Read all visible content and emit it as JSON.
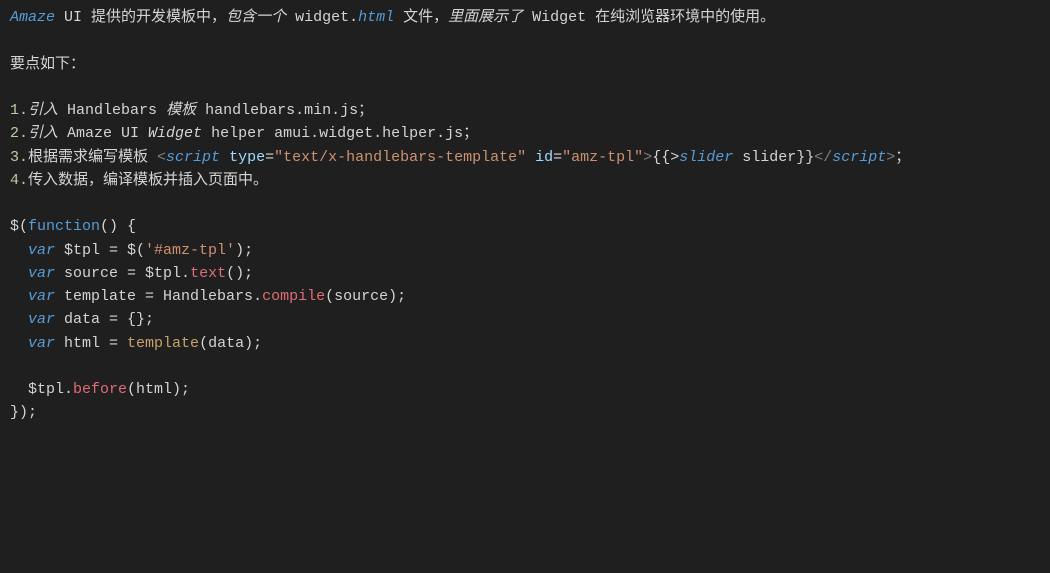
{
  "intro": {
    "w1": "Amaze",
    "w2": " UI ",
    "w3": "提供的开发模板中，",
    "w4": "包含一个",
    "w5": " widget.",
    "w6": "html",
    "w7": " 文件，",
    "w8": "里面展示了",
    "w9": " Widget ",
    "w10": "在纯浏览器环境中的使用。"
  },
  "points_header": "要点如下：",
  "list": {
    "n1": "1.",
    "n2": "2.",
    "n3": "3.",
    "n4": "4.",
    "i1a": "引入",
    "i1b": " Handlebars ",
    "i1c": "模板",
    "i1d": " handlebars.min.js；",
    "i2a": "引入",
    "i2b": " Amaze UI ",
    "i2c": "Widget",
    "i2d": " helper amui.widget.helper.js；",
    "i3a": "根据需求编写模板 ",
    "i3b": "<",
    "i3c": "script",
    "i3d": " type",
    "i3e": "=",
    "i3f": "\"text/x-handlebars-template\"",
    "i3g": " id",
    "i3h": "=",
    "i3i": "\"amz-tpl\"",
    "i3j": ">",
    "i3k": "{{>",
    "i3l": "slider",
    "i3m": " slider}}",
    "i3n": "</",
    "i3o": "script",
    "i3p": ">",
    "i3q": "；",
    "i4": "传入数据，编译模板并插入页面中。"
  },
  "code": {
    "l1a": "$(",
    "l1b": "function",
    "l1c": "() {",
    "l2a": "  ",
    "l2b": "var",
    "l2c": " $tpl = $(",
    "l2d": "'#amz-tpl'",
    "l2e": ");",
    "l3a": "  ",
    "l3b": "var",
    "l3c": " source = $tpl.",
    "l3d": "text",
    "l3e": "();",
    "l4a": "  ",
    "l4b": "var",
    "l4c": " template = Handlebars.",
    "l4d": "compile",
    "l4e": "(source);",
    "l5a": "  ",
    "l5b": "var",
    "l5c": " data = {};",
    "l6a": "  ",
    "l6b": "var",
    "l6c": " html = ",
    "l6d": "template",
    "l6e": "(data);",
    "l8a": "  $tpl.",
    "l8b": "before",
    "l8c": "(html);",
    "l9": "});"
  }
}
